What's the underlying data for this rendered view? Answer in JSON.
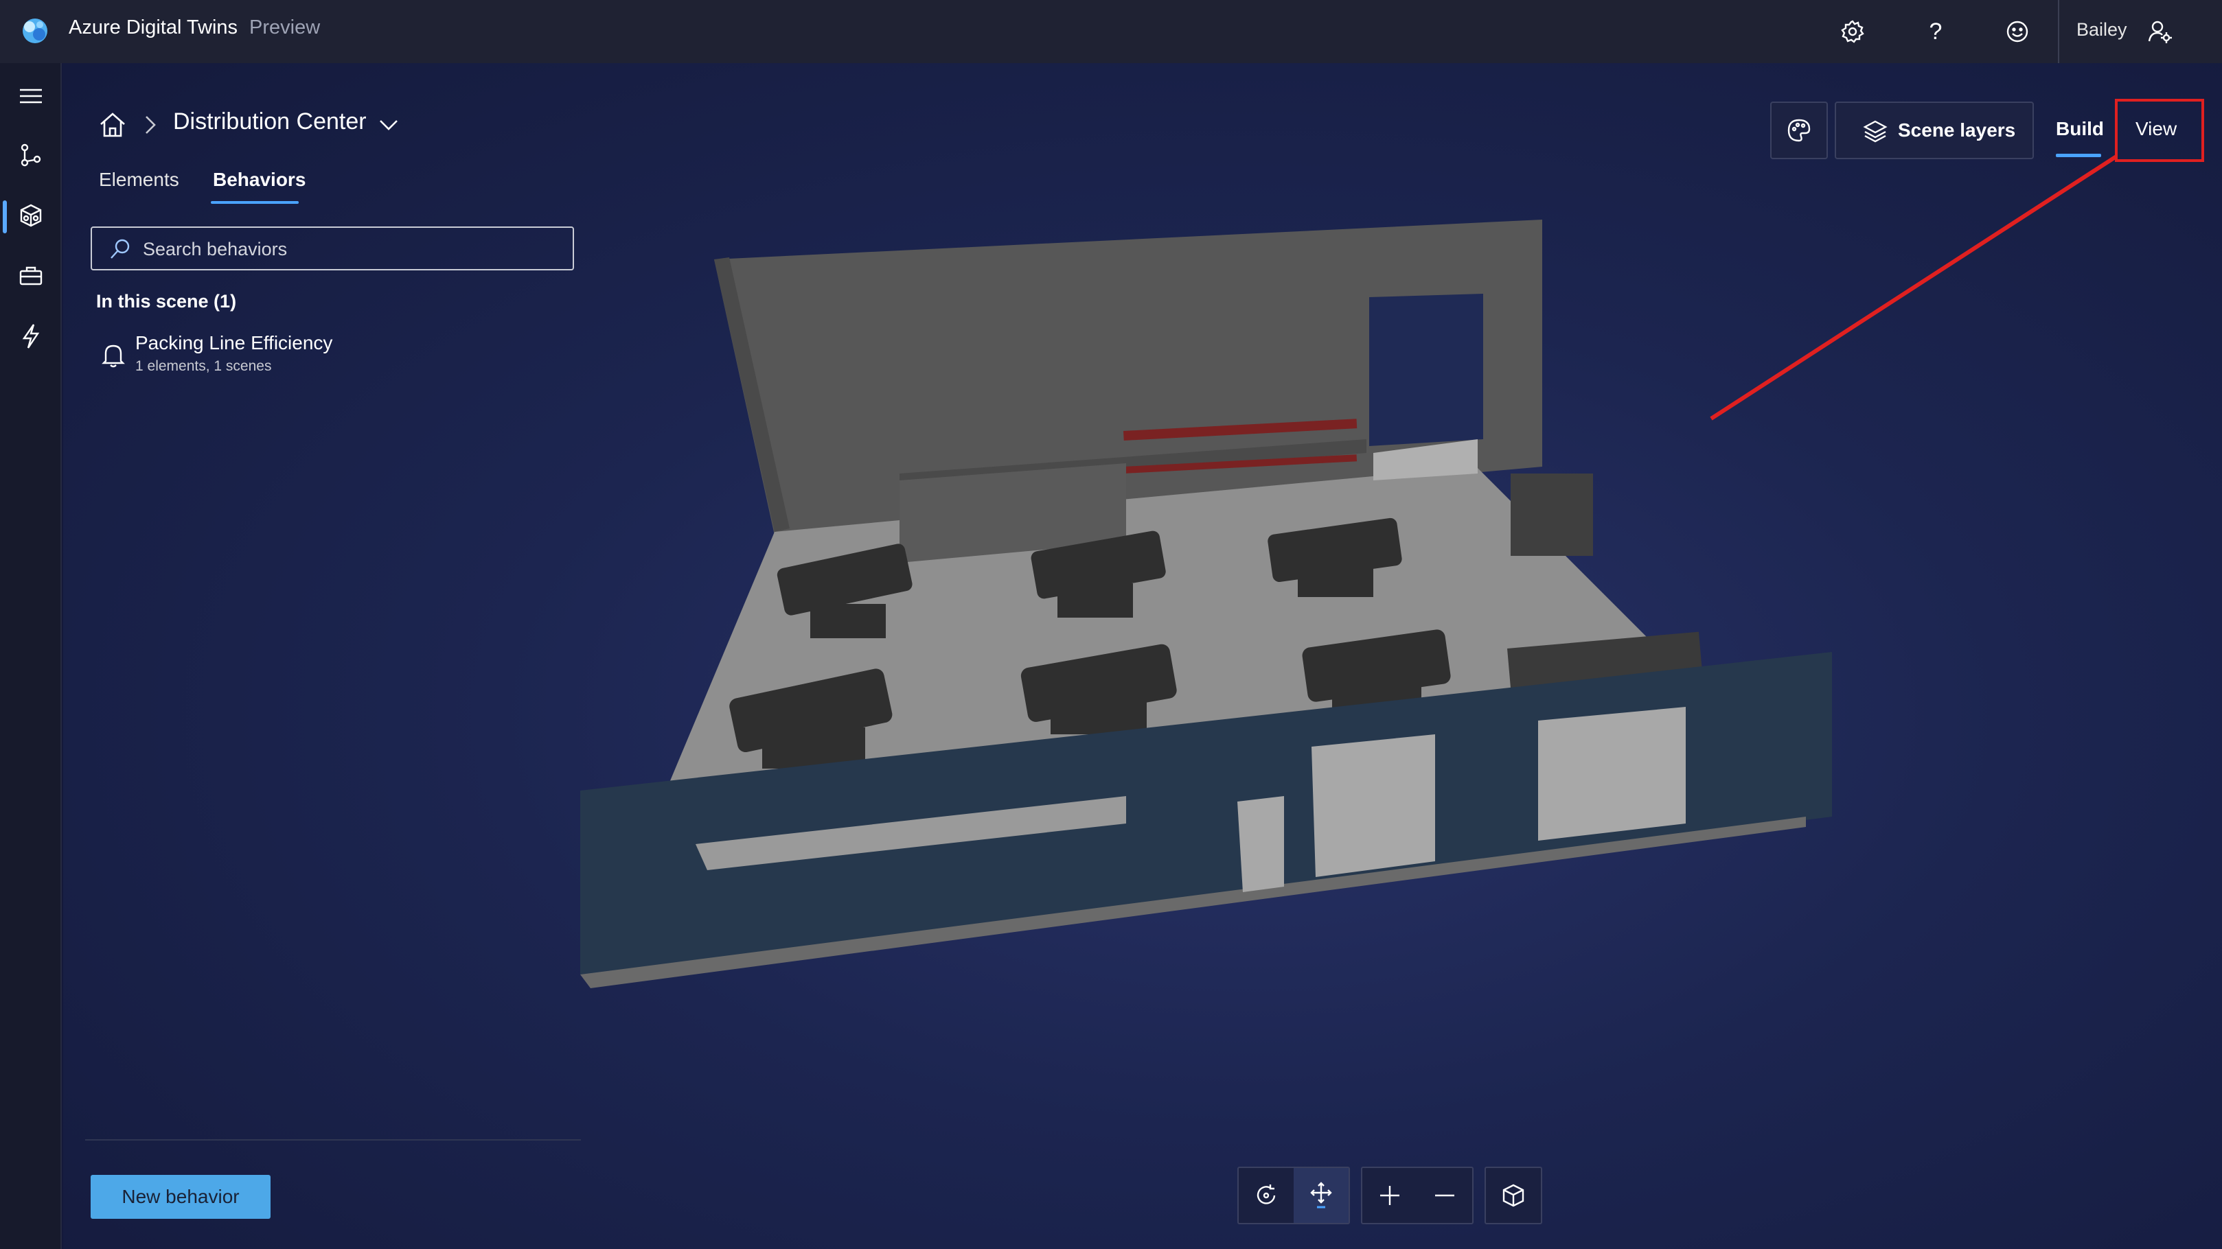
{
  "app": {
    "title": "Azure Digital Twins",
    "badge": "Preview"
  },
  "topbar": {
    "user_name": "Bailey",
    "icons": [
      "settings-icon",
      "help-icon",
      "feedback-icon",
      "account-settings-icon"
    ]
  },
  "rail": {
    "items": [
      "menu-icon",
      "twins-graph-icon",
      "scenes-icon",
      "toolbox-icon",
      "events-icon"
    ],
    "active_index": 2
  },
  "breadcrumb": {
    "scene_name": "Distribution Center"
  },
  "panel": {
    "tabs": [
      "Elements",
      "Behaviors"
    ],
    "active_tab": "Behaviors",
    "search_placeholder": "Search behaviors",
    "section_label": "In this scene (1)",
    "behaviors": [
      {
        "name": "Packing Line Efficiency",
        "meta": "1 elements, 1 scenes"
      }
    ],
    "new_behavior_label": "New behavior"
  },
  "toolbar": {
    "scene_layers_label": "Scene layers",
    "modes": [
      "Build",
      "View"
    ],
    "active_mode": "Build"
  },
  "bottom_toolbar": {
    "buttons": [
      "orbit-icon",
      "pan-icon",
      "zoom-in-icon",
      "zoom-out-icon",
      "reset-view-icon"
    ],
    "active": "pan-icon"
  },
  "colors": {
    "accent": "#4aa3ff",
    "primary_button": "#4da8e8",
    "annotation_red": "#e02020"
  }
}
